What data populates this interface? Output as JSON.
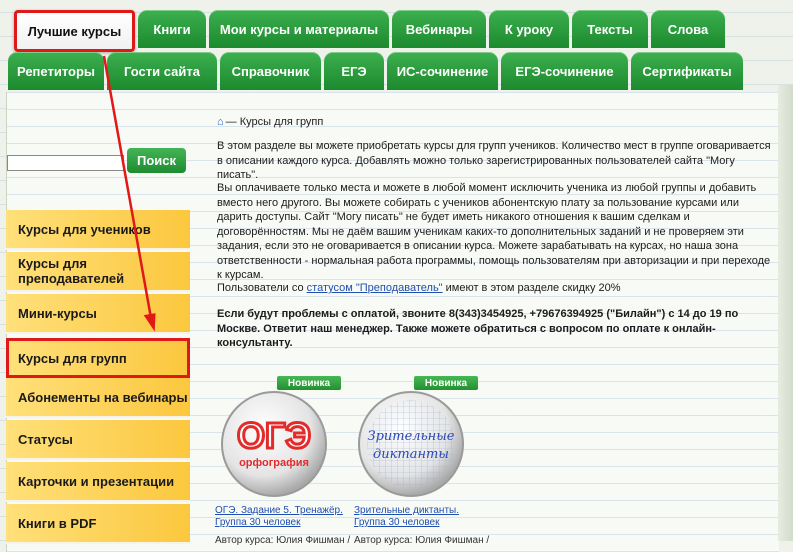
{
  "nav": {
    "row1": [
      {
        "label": "Лучшие курсы",
        "active": true
      },
      {
        "label": "Книги"
      },
      {
        "label": "Мои курсы и материалы"
      },
      {
        "label": "Вебинары"
      },
      {
        "label": "К уроку"
      },
      {
        "label": "Тексты"
      },
      {
        "label": "Слова"
      }
    ],
    "row2": [
      {
        "label": "Репетиторы"
      },
      {
        "label": "Гости сайта"
      },
      {
        "label": "Справочник"
      },
      {
        "label": "ЕГЭ"
      },
      {
        "label": "ИС-сочинение"
      },
      {
        "label": "ЕГЭ-сочинение"
      },
      {
        "label": "Сертификаты"
      }
    ]
  },
  "search": {
    "button_label": "Поиск",
    "value": ""
  },
  "sidebar": {
    "items": [
      {
        "label": "Курсы для учеников"
      },
      {
        "label": "Курсы для преподавателей"
      },
      {
        "label": "Мини-курсы"
      },
      {
        "label": "Курсы для групп",
        "active": true
      },
      {
        "label": "Абонементы на вебинары"
      },
      {
        "label": "Статусы"
      },
      {
        "label": "Карточки и презентации"
      },
      {
        "label": "Книги в PDF"
      }
    ]
  },
  "breadcrumb": {
    "home_icon": "home-icon",
    "text": "— Курсы для групп"
  },
  "content": {
    "p1": "В этом разделе вы можете приобретать курсы для групп учеников. Количество мест в группе оговаривается в описании каждого курса. Добавлять можно только зарегистрированных пользователей сайта \"Могу писать\".",
    "p2": "Вы оплачиваете только места и можете в любой момент исключить ученика из любой группы и добавить вместо него другого. Вы можете собирать с учеников абонентскую плату за пользование курсами или дарить доступы. Сайт \"Могу писать\" не будет иметь никакого отношения к вашим сделкам и договорённостям. Мы не даём вашим ученикам каких-то дополнительных заданий и не проверяем эти задания, если это не оговаривается в описании курса. Можете зарабатывать на курсах, но наша зона ответственности - нормальная работа программы, помощь пользователям при авторизации и при переходе к курсам.",
    "p3_before": "Пользователи со ",
    "p3_link": "статусом \"Преподаватель\"",
    "p3_after": " имеют в этом разделе скидку 20%",
    "p4": "Если будут проблемы с оплатой, звоните 8(343)3454925,  +79676394925 (\"Билайн\") с 14 до 19 по Москве. Ответит наш менеджер. Также можете обратиться с вопросом по оплате к онлайн-консультанту."
  },
  "courses": [
    {
      "badge": "Новинка",
      "logo_text": "ОГЭ",
      "logo_sub": "орфография",
      "title_line1": "ОГЭ. Задание 5. Тренажёр.",
      "title_line2": "Группа 30 человек",
      "author": "Автор курса: Юлия Фишман /"
    },
    {
      "badge": "Новинка",
      "logo_text": "Зрительные",
      "logo_sub": "диктанты",
      "title_line1": "Зрительные диктанты.",
      "title_line2": "Группа 30 человек",
      "author": "Автор курса: Юлия Фишман /"
    }
  ],
  "colors": {
    "accent_green": "#1c8a2e",
    "highlight_red": "#e01818",
    "sidebar_yellow": "#fbc73e",
    "link_blue": "#1f4fb0"
  }
}
